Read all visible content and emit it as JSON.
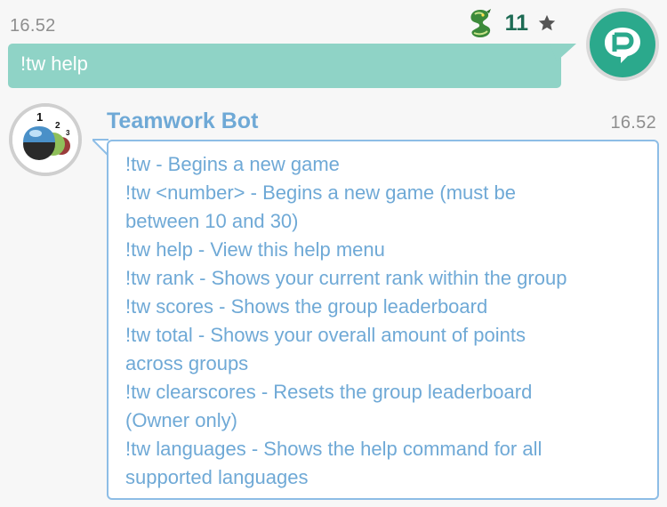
{
  "outgoing": {
    "time": "16.52",
    "text": "!tw help",
    "level": "11",
    "badge_icon": "dragon-icon",
    "rank_icon": "star-icon",
    "avatar_icon": "paltalk-logo-icon"
  },
  "incoming": {
    "sender": "Teamwork Bot",
    "time": "16.52",
    "avatar_icon": "podium-123-icon",
    "lines": [
      "!tw - Begins a new game",
      "!tw <number> - Begins a new game (must be",
      "between 10 and 30)",
      "!tw help - View this help menu",
      "!tw rank - Shows your current rank within the group",
      "!tw scores - Shows the group leaderboard",
      "!tw total - Shows your overall amount of points",
      "across groups",
      "!tw clearscores - Resets the group leaderboard",
      "(Owner only)",
      "!tw languages - Shows the help command for all",
      "supported languages"
    ]
  },
  "colors": {
    "outgoing_bubble": "#8fd3c6",
    "incoming_text": "#6fa9d6",
    "incoming_border": "#8dbde6",
    "level_text": "#1d6b54",
    "timestamp": "#8e8e8e",
    "avatar_green": "#2ba98c"
  }
}
